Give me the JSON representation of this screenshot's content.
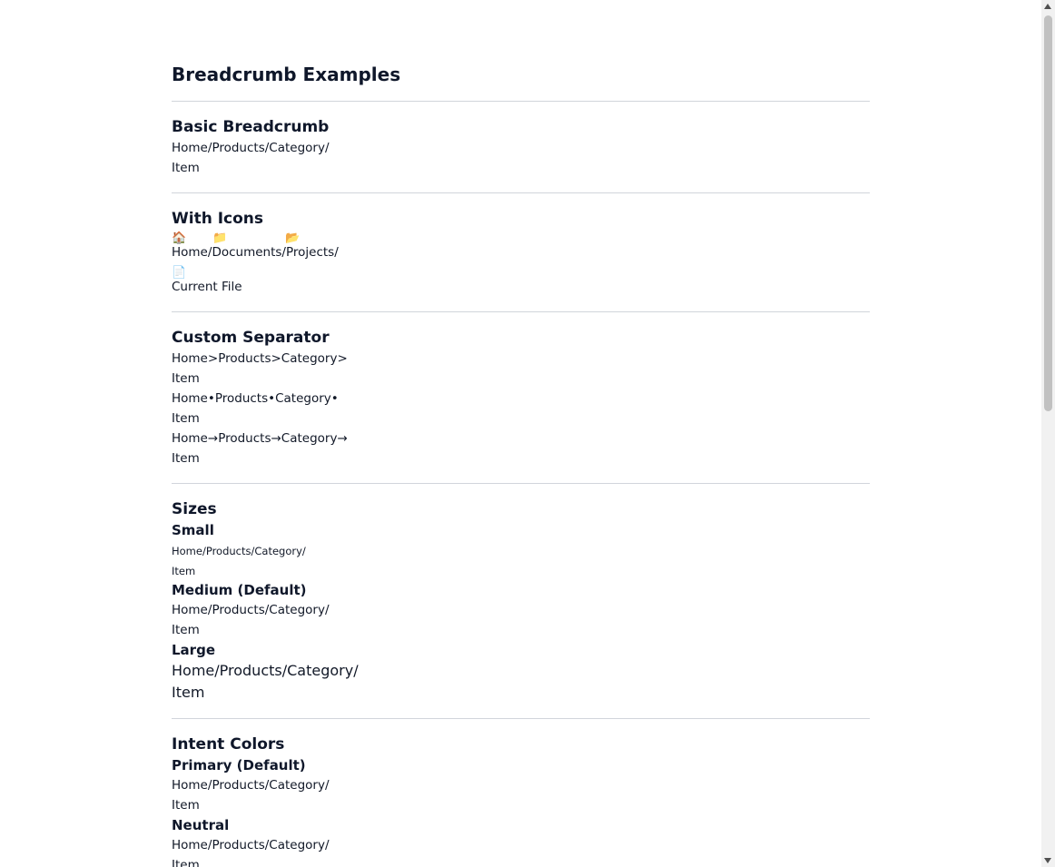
{
  "page": {
    "title": "Breadcrumb Examples"
  },
  "basic": {
    "title": "Basic Breadcrumb",
    "items": [
      "Home",
      "Products",
      "Category"
    ],
    "separator": "/",
    "current": "Item"
  },
  "icons": {
    "title": "With Icons",
    "items": [
      {
        "icon": "🏠",
        "icon_name": "home-icon",
        "label": "Home"
      },
      {
        "icon": "📁",
        "icon_name": "folder-icon",
        "label": "Documents"
      },
      {
        "icon": "📂",
        "icon_name": "open-folder-icon",
        "label": "Projects"
      }
    ],
    "separator": "/",
    "current": {
      "icon": "📄",
      "icon_name": "file-icon",
      "label": "Current File"
    }
  },
  "custom_separator": {
    "title": "Custom Separator",
    "rows": [
      {
        "separator": ">",
        "items": [
          "Home",
          "Products",
          "Category"
        ],
        "current": "Item"
      },
      {
        "separator": "•",
        "items": [
          "Home",
          "Products",
          "Category"
        ],
        "current": "Item"
      },
      {
        "separator": "→",
        "items": [
          "Home",
          "Products",
          "Category"
        ],
        "current": "Item"
      }
    ]
  },
  "sizes": {
    "title": "Sizes",
    "small": {
      "label": "Small",
      "items": [
        "Home",
        "Products",
        "Category"
      ],
      "separator": "/",
      "current": "Item"
    },
    "medium": {
      "label": "Medium (Default)",
      "items": [
        "Home",
        "Products",
        "Category"
      ],
      "separator": "/",
      "current": "Item"
    },
    "large": {
      "label": "Large",
      "items": [
        "Home",
        "Products",
        "Category"
      ],
      "separator": "/",
      "current": "Item"
    }
  },
  "intent": {
    "title": "Intent Colors",
    "primary": {
      "label": "Primary (Default)",
      "items": [
        "Home",
        "Products",
        "Category"
      ],
      "separator": "/",
      "current": "Item"
    },
    "neutral": {
      "label": "Neutral",
      "items": [
        "Home",
        "Products",
        "Category"
      ],
      "separator": "/",
      "current": "Item"
    }
  },
  "colors": {
    "text": "#0f172a",
    "divider": "#d1d5db"
  }
}
